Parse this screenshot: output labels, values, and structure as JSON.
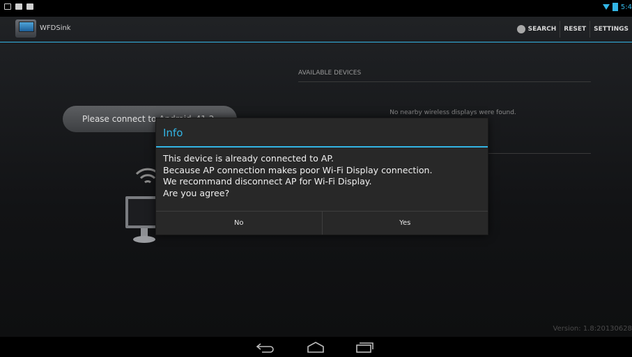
{
  "status_bar": {
    "left_icons": [
      "screenshot-icon",
      "gallery-icon",
      "notification-icon"
    ],
    "time": "5:4",
    "right_icons": [
      "wifi-signal-icon",
      "battery-icon"
    ]
  },
  "action_bar": {
    "app_title": "WFDSink",
    "actions": {
      "search": "SEARCH",
      "reset": "RESET",
      "settings": "SETTINGS"
    }
  },
  "left_pane": {
    "connect_text": "Please connect to Android_41.2..."
  },
  "right_pane": {
    "section_header": "AVAILABLE DEVICES",
    "empty_message": "No nearby wireless displays were found.",
    "version": "Version: 1.8:20130628"
  },
  "dialog": {
    "title": "Info",
    "message_lines": [
      "This device is already connected to AP.",
      "Because AP connection makes poor Wi-Fi Display connection.",
      "We recommand disconnect AP for Wi-Fi Display.",
      "Are you agree?"
    ],
    "buttons": {
      "no": "No",
      "yes": "Yes"
    }
  },
  "nav_bar": {
    "icons": [
      "back-icon",
      "home-icon",
      "recent-apps-icon"
    ]
  },
  "colors": {
    "accent": "#33b5e5",
    "background": "#000000",
    "dialog": "#282828"
  }
}
